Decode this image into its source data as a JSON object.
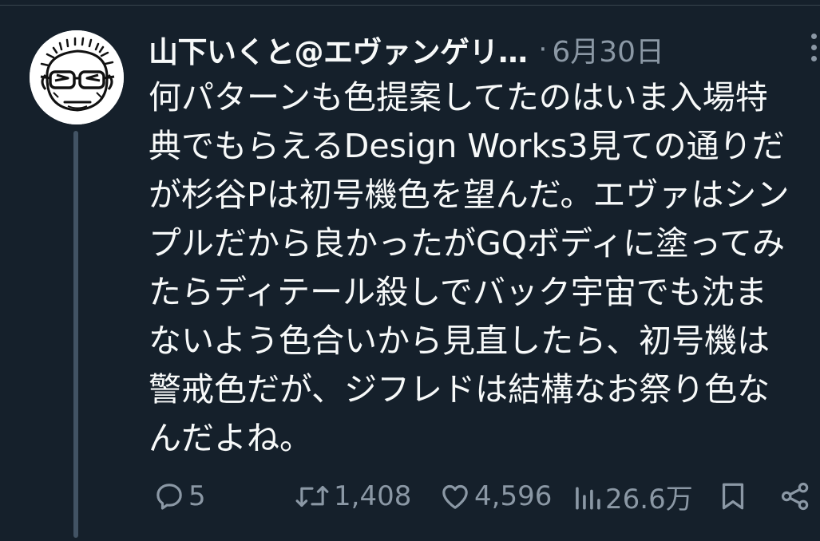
{
  "tweet": {
    "author": {
      "display_name": "山下いくと@エヴァンゲリ…",
      "avatar_icon": "cartoon-avatar"
    },
    "separator": "·",
    "date": "6月30日",
    "more_icon": "more-vertical-icon",
    "text_lines": [
      "何パターンも色提案してたのはいま入場特",
      "典でもらえるDesign Works3見ての通りだ",
      "が杉谷Pは初号機色を望んだ。エヴァはシン",
      "プルだから良かったがGQボディに塗ってみ",
      "たらディテール殺しでバック宇宙でも沈ま",
      "ないよう色合いから見直したら、初号機は",
      "警戒色だが、ジフレドは結構なお祭り色な",
      "んだよね。"
    ],
    "actions": {
      "reply": {
        "icon": "reply-icon",
        "count": "5"
      },
      "retweet": {
        "icon": "retweet-icon",
        "count": "1,408"
      },
      "like": {
        "icon": "heart-icon",
        "count": "4,596"
      },
      "views": {
        "icon": "views-icon",
        "count": "26.6万"
      },
      "bookmark": {
        "icon": "bookmark-icon"
      },
      "share": {
        "icon": "share-icon"
      }
    }
  },
  "colors": {
    "background": "#15202b",
    "primary_text": "#f7f9f9",
    "secondary_text": "#8b98a5",
    "thread_line": "#425364"
  }
}
